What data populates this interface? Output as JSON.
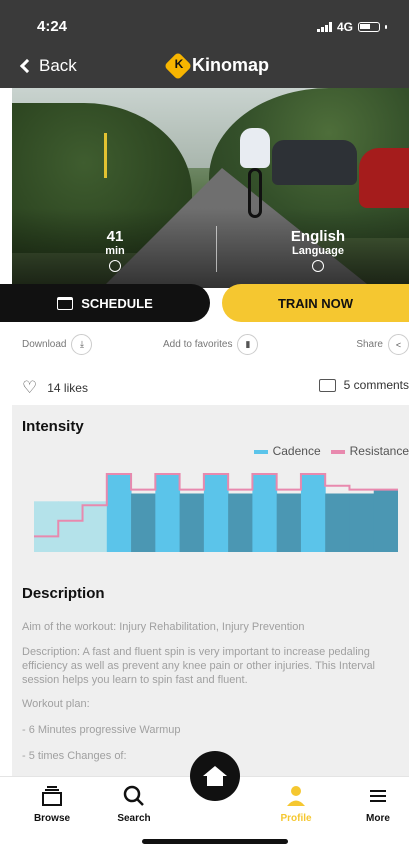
{
  "status_bar": {
    "time": "4:24",
    "network": "4G"
  },
  "header": {
    "back_label": "Back",
    "logo_text": "Kinomap"
  },
  "video": {
    "duration_value": "41",
    "duration_unit": "min",
    "language_value": "English",
    "language_label": "Language"
  },
  "actions": {
    "schedule_label": "SCHEDULE",
    "train_label": "TRAIN NOW",
    "download_label": "Download",
    "favorites_label": "Add to favorites",
    "share_label": "Share"
  },
  "social": {
    "likes": "14 likes",
    "comments": "5 comments"
  },
  "intensity": {
    "title": "Intensity",
    "legend": [
      {
        "name": "Cadence",
        "color": "#5bc4ea"
      },
      {
        "name": "Resistance",
        "color": "#e889ae"
      }
    ]
  },
  "chart_data": {
    "type": "bar",
    "categories": [
      "1",
      "2",
      "3",
      "4",
      "5",
      "6",
      "7",
      "8",
      "9",
      "10",
      "11",
      "12",
      "13",
      "14",
      "15"
    ],
    "series": [
      {
        "name": "Cadence",
        "values": [
          65,
          65,
          65,
          100,
          75,
          100,
          75,
          100,
          75,
          100,
          75,
          100,
          75,
          75,
          80
        ]
      },
      {
        "name": "Resistance",
        "values": [
          20,
          40,
          60,
          100,
          80,
          100,
          80,
          100,
          80,
          100,
          80,
          100,
          85,
          80,
          80
        ]
      }
    ],
    "colors": {
      "cadence": "#5bc4ea",
      "cadence_dark": "#4b97b3",
      "cadence_light": "#b4e2ea",
      "resistance": "#e889ae"
    }
  },
  "description": {
    "title": "Description",
    "paragraphs": [
      "Aim of the workout: Injury Rehabilitation, Injury Prevention",
      "Description: A fast and fluent spin is very important to increase pedaling efficiency as well as prevent any knee pain or other injuries. This Interval session helps you learn to spin fast and fluent.",
      "Workout plan:",
      "- 6 Minutes progressive Warmup",
      "- 5 times Changes of:"
    ]
  },
  "nav": {
    "browse": "Browse",
    "search": "Search",
    "profile": "Profile",
    "more": "More",
    "active_color": "#f5c730"
  }
}
